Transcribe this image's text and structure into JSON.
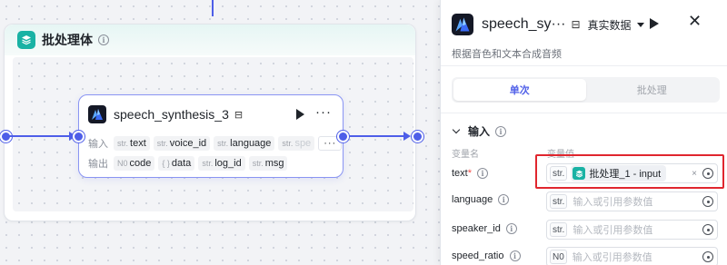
{
  "canvas": {
    "batch": {
      "title": "批处理体"
    },
    "node": {
      "title": "speech_synthesis_3",
      "save_glyph": "⊟",
      "more_glyph": "···",
      "inputs_label": "输入",
      "outputs_label": "输出",
      "inputs": [
        {
          "type": "str.",
          "name": "text"
        },
        {
          "type": "str.",
          "name": "voice_id"
        },
        {
          "type": "str.",
          "name": "language"
        },
        {
          "type": "str.",
          "name": "spe"
        }
      ],
      "inputs_more": "···",
      "outputs": [
        {
          "type": "N0",
          "name": "code"
        },
        {
          "type": "{ }",
          "name": "data"
        },
        {
          "type": "str.",
          "name": "log_id"
        },
        {
          "type": "str.",
          "name": "msg"
        }
      ]
    },
    "colors": {
      "accent": "#4e5ee8",
      "batch_teal": "#19b2a4"
    }
  },
  "panel": {
    "title": "speech_sy···",
    "save_glyph": "⊟",
    "data_mode": "真实数据",
    "close_glyph": "✕",
    "description": "根据音色和文本合成音频",
    "tabs": [
      {
        "label": "单次",
        "active": true
      },
      {
        "label": "批处理",
        "active": false
      }
    ],
    "section_title": "输入",
    "col_name": "变量名",
    "col_value": "变量值",
    "params": [
      {
        "name": "text",
        "required": true,
        "type": "str.",
        "reference": "批处理_1 - input",
        "placeholder": ""
      },
      {
        "name": "language",
        "required": false,
        "type": "str.",
        "reference": "",
        "placeholder": "输入或引用参数值"
      },
      {
        "name": "speaker_id",
        "required": false,
        "type": "str.",
        "reference": "",
        "placeholder": "输入或引用参数值"
      },
      {
        "name": "speed_ratio",
        "required": false,
        "type": "N0",
        "reference": "",
        "placeholder": "输入或引用参数值"
      }
    ],
    "clear_glyph": "×",
    "highlight_color": "#e0262e"
  }
}
